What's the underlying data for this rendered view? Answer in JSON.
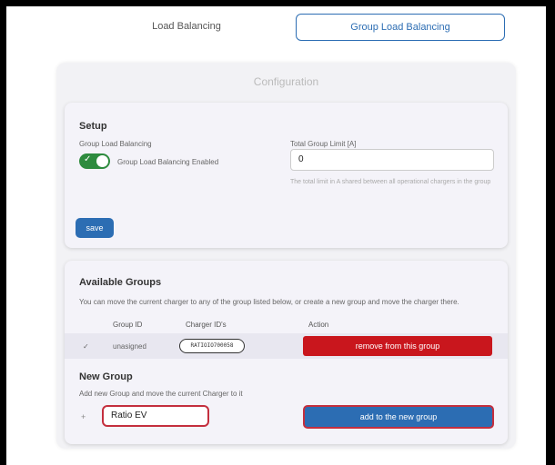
{
  "tabs": [
    {
      "label": "Load Balancing",
      "active": false
    },
    {
      "label": "Group Load Balancing",
      "active": true
    }
  ],
  "panel": {
    "title": "Configuration"
  },
  "setup": {
    "heading": "Setup",
    "group_lb_label": "Group Load Balancing",
    "toggle_label": "Group Load Balancing Enabled",
    "toggle_on": true,
    "limit_label": "Total Group Limit [A]",
    "limit_value": "0",
    "limit_hint": "The total limit in A shared between all operational chargers in the group",
    "save_label": "save"
  },
  "groups": {
    "heading": "Available Groups",
    "description": "You can move the current charger to any of the group listed below, or create a new group and move the charger there.",
    "columns": [
      "Group ID",
      "Charger ID's",
      "Action"
    ],
    "rows": [
      {
        "check": "✓",
        "group_id": "unasigned",
        "charger_id": "RATIOIO700058",
        "action_label": "remove from this group"
      }
    ]
  },
  "new_group": {
    "heading": "New Group",
    "description": "Add new Group and move the current Charger to it",
    "plus": "+",
    "name_value": "Ratio EV",
    "add_label": "add to the new group"
  },
  "colors": {
    "primary": "#2c6db3",
    "danger": "#c9161d",
    "toggle_on": "#2e8b3e",
    "highlight_outline": "#c42f3e"
  }
}
